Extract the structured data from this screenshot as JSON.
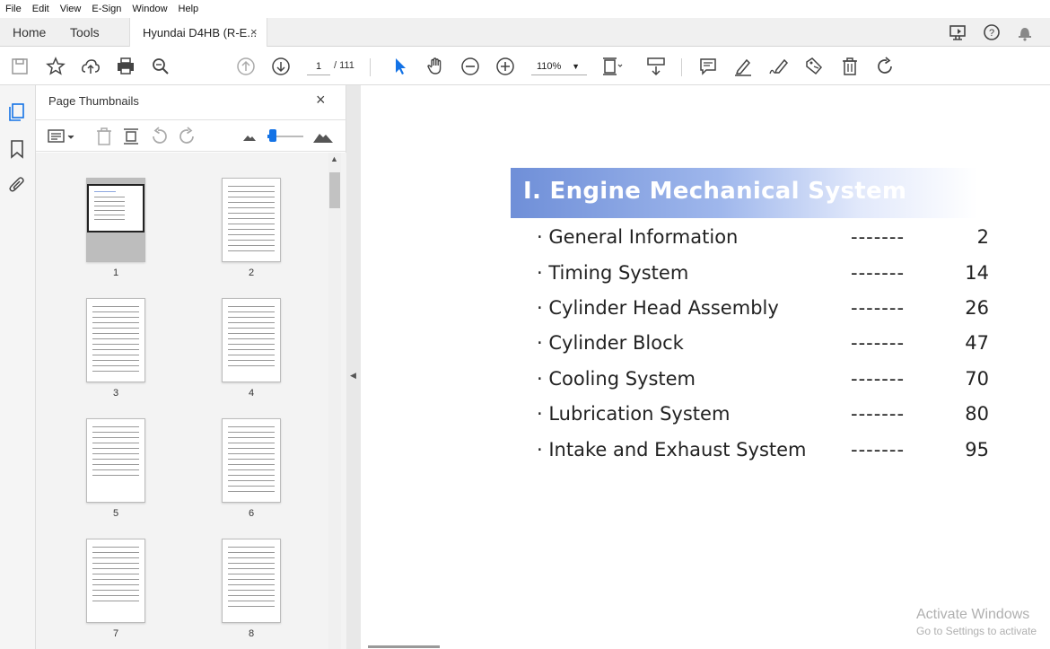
{
  "menu": [
    "File",
    "Edit",
    "View",
    "E-Sign",
    "Window",
    "Help"
  ],
  "tabs": {
    "home": "Home",
    "tools": "Tools",
    "document": "Hyundai D4HB (R-E...",
    "close": "×"
  },
  "toolbar": {
    "page_current": "1",
    "page_total": "/ 111",
    "zoom": "110%"
  },
  "thumbnails_panel": {
    "title": "Page Thumbnails",
    "close": "×",
    "pages": [
      "1",
      "2",
      "3",
      "4",
      "5",
      "6",
      "7",
      "8"
    ]
  },
  "document": {
    "section_title": "Ⅰ. Engine Mechanical System",
    "toc": [
      {
        "label": "· General Information",
        "dashes": "-------",
        "page": "2"
      },
      {
        "label": "· Timing System",
        "dashes": "-------",
        "page": "14"
      },
      {
        "label": "· Cylinder Head Assembly",
        "dashes": "-------",
        "page": "26"
      },
      {
        "label": "· Cylinder Block",
        "dashes": "-------",
        "page": "47"
      },
      {
        "label": "· Cooling System",
        "dashes": "-------",
        "page": "70"
      },
      {
        "label": "· Lubrication System",
        "dashes": "-------",
        "page": "80"
      },
      {
        "label": "· Intake and Exhaust System",
        "dashes": "-------",
        "page": "95"
      }
    ]
  },
  "watermark": {
    "line1": "Activate Windows",
    "line2": "Go to Settings to activate"
  },
  "colors": {
    "accent": "#1473e6",
    "banner_start": "#6f8fd8"
  }
}
